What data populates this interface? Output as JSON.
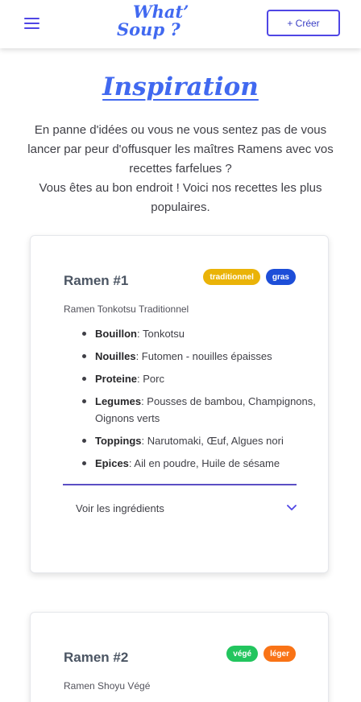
{
  "header": {
    "logo_line1": "What’",
    "logo_line2": "Soup ?",
    "create_label": "+ Créer",
    "accent": "#4f46e5"
  },
  "page": {
    "title": "Inspiration",
    "intro_p1": "En panne d'idées ou vous ne vous sentez pas de vous lancer par peur d'offusquer les maîtres Ramens avec vos recettes farfelues ?",
    "intro_p2": "Vous êtes au bon endroit ! Voici nos recettes les plus populaires."
  },
  "recipes": [
    {
      "title": "Ramen #1",
      "subtitle": "Ramen Tonkotsu Traditionnel",
      "badges": [
        {
          "label": "traditionnel",
          "color": "#eab308"
        },
        {
          "label": "gras",
          "color": "#1d4ed8"
        }
      ],
      "ingredients": [
        {
          "name": "Bouillon",
          "value": ": Tonkotsu"
        },
        {
          "name": "Nouilles",
          "value": ": Futomen - nouilles épaisses"
        },
        {
          "name": "Proteine",
          "value": ": Porc"
        },
        {
          "name": "Legumes",
          "value": ": Pousses de bambou, Champignons, Oignons verts"
        },
        {
          "name": "Toppings",
          "value": ": Narutomaki, Œuf, Algues nori"
        },
        {
          "name": "Epices",
          "value": ": Ail en poudre, Huile de sésame"
        }
      ],
      "toggle_label": "Voir les ingrédients"
    },
    {
      "title": "Ramen #2",
      "subtitle": "Ramen Shoyu Végé",
      "badges": [
        {
          "label": "végé",
          "color": "#22c55e"
        },
        {
          "label": "léger",
          "color": "#f97316"
        }
      ]
    }
  ]
}
